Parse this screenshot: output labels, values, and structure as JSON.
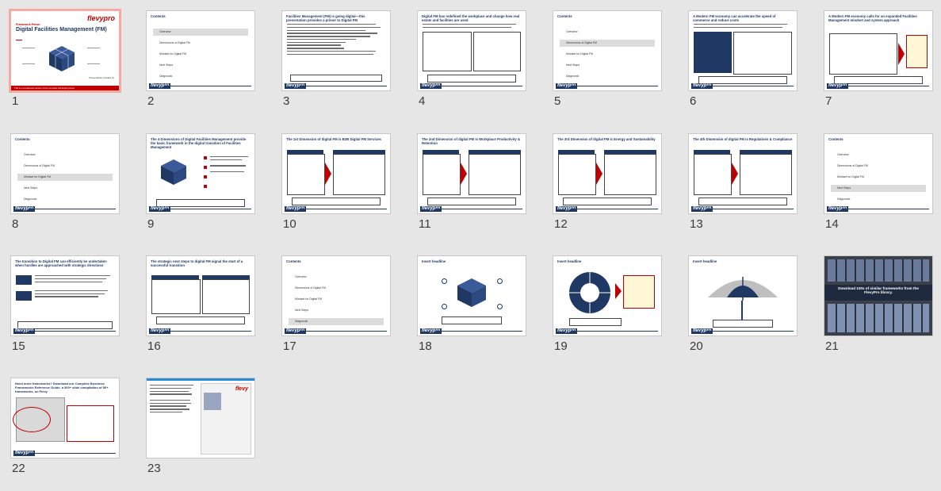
{
  "slides": [
    {
      "num": "1",
      "title": "Digital Facilities Management (FM)",
      "kicker": "Framework Primer",
      "logo": "flevypro",
      "caption": "Presentation created by",
      "footer": "This is a condensed version of the complete full-length primer"
    },
    {
      "num": "2",
      "title": "Contents",
      "toc": [
        "Overview",
        "Dimensions of Digital FM",
        "Mindset for Digital FM",
        "Next Steps",
        "Diagnostic"
      ]
    },
    {
      "num": "3",
      "title": "Facilities Management (FM) is going digital—this presentation provides a primer to Digital FM"
    },
    {
      "num": "4",
      "title": "Digital FM has redefined the workplace and change how real estate and facilities are used"
    },
    {
      "num": "5",
      "title": "Contents",
      "toc": [
        "Overview",
        "Dimensions of Digital FM",
        "Mindset for Digital FM",
        "Next Steps",
        "Diagnostic"
      ]
    },
    {
      "num": "6",
      "title": "A Modern FM economy can accelerate the speed of commerce and reduce costs"
    },
    {
      "num": "7",
      "title": "A Modern FM economy calls for an expanded Facilities Management mindset and system approach"
    },
    {
      "num": "8",
      "title": "Contents",
      "toc": [
        "Overview",
        "Dimensions of Digital FM",
        "Mindset for Digital FM",
        "Next Steps",
        "Diagnostic"
      ]
    },
    {
      "num": "9",
      "title": "The 4 Dimensions of Digital Facilities Management provide the basic framework in the digital transition of Facilities Management"
    },
    {
      "num": "10",
      "title": "The 1st Dimension of digital FM is B2B Digital FM Services"
    },
    {
      "num": "11",
      "title": "The 2nd Dimension of digital FM is Workplace Productivity & Retention"
    },
    {
      "num": "12",
      "title": "The 3rd Dimension of digital FM is Energy and Sustainability"
    },
    {
      "num": "13",
      "title": "The 4th Dimension of digital FM is Regulations & Compliance"
    },
    {
      "num": "14",
      "title": "Contents",
      "toc": [
        "Overview",
        "Dimensions of Digital FM",
        "Mindset for Digital FM",
        "Next Steps",
        "Diagnostic"
      ]
    },
    {
      "num": "15",
      "title": "The transition to Digital FM can efficiently be undertaken when hurdles are approached with strategic directions"
    },
    {
      "num": "16",
      "title": "The strategic next steps to digital FM signal the start of a successful transition"
    },
    {
      "num": "17",
      "title": "Contents",
      "toc": [
        "Overview",
        "Dimensions of Digital FM",
        "Mindset for Digital FM",
        "Next Steps",
        "Diagnostic"
      ]
    },
    {
      "num": "18",
      "title": "Insert headline"
    },
    {
      "num": "19",
      "title": "Insert headline"
    },
    {
      "num": "20",
      "title": "Insert headline"
    },
    {
      "num": "21",
      "title": "Download 100s of similar frameworks from the FlevyPro library."
    },
    {
      "num": "22",
      "title": "Need more frameworks? Download our Complete Business Frameworks Reference Guide, a 300+ slide compilation of 50+ frameworks, on Flevy"
    },
    {
      "num": "23",
      "title": "",
      "logo": "flevy"
    }
  ],
  "selected_slide": "1",
  "colors": {
    "navy": "#1f3864",
    "accent_red": "#c00000",
    "selection": "#f4a9a3",
    "panel_bg": "#e6e6e6"
  }
}
